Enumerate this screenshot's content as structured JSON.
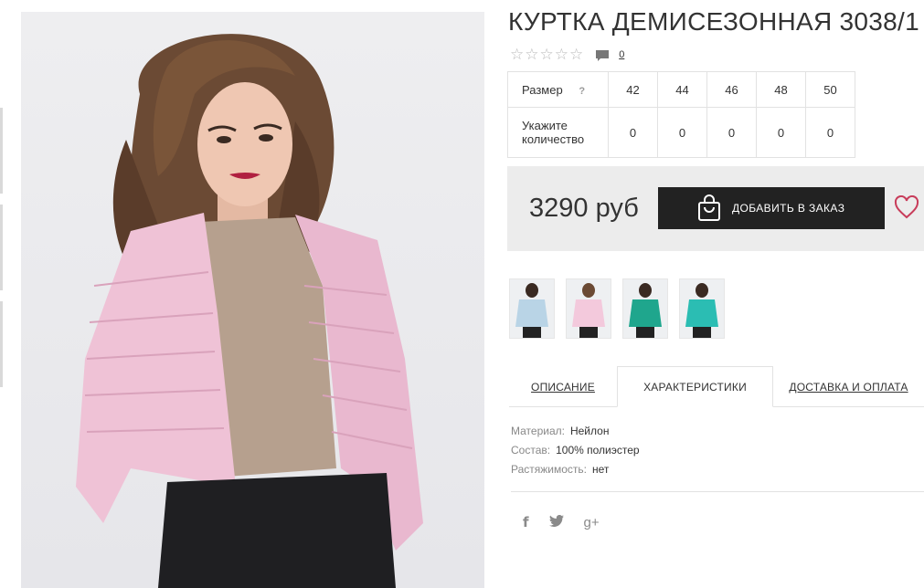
{
  "product": {
    "title": "КУРТКА ДЕМИСЕЗОННАЯ 3038/1",
    "rating_stars": "☆☆☆☆☆",
    "comments_count": "0",
    "image_icon": "product-photo-pink-jacket"
  },
  "size_table": {
    "size_label": "Размер",
    "help_mark": "?",
    "qty_label": "Укажите количество",
    "sizes": [
      "42",
      "44",
      "46",
      "48",
      "50"
    ],
    "quantities": [
      "0",
      "0",
      "0",
      "0",
      "0"
    ]
  },
  "purchase": {
    "price": "3290 руб",
    "add_button_label": "ДОБАВИТЬ В ЗАКАЗ",
    "accent_color": "#c83c5a"
  },
  "variants": [
    {
      "color": "#b9d4e6",
      "icon": "light-blue-jacket-thumb"
    },
    {
      "color": "#f3c9dc",
      "icon": "pink-jacket-thumb"
    },
    {
      "color": "#1fa68d",
      "icon": "green-jacket-thumb"
    },
    {
      "color": "#2bbdb3",
      "icon": "turquoise-jacket-thumb"
    }
  ],
  "tabs": [
    {
      "label": "ОПИСАНИЕ",
      "active": false
    },
    {
      "label": "ХАРАКТЕРИСТИКИ",
      "active": true
    },
    {
      "label": "ДОСТАВКА И ОПЛАТА",
      "active": false
    }
  ],
  "specs": [
    {
      "key": "Материал:",
      "value": "Нейлон"
    },
    {
      "key": "Состав:",
      "value": "100% полиэстер"
    },
    {
      "key": "Растяжимость:",
      "value": "нет"
    }
  ],
  "social": {
    "facebook": "f",
    "twitter": "𝕥",
    "google_plus": "g+"
  }
}
